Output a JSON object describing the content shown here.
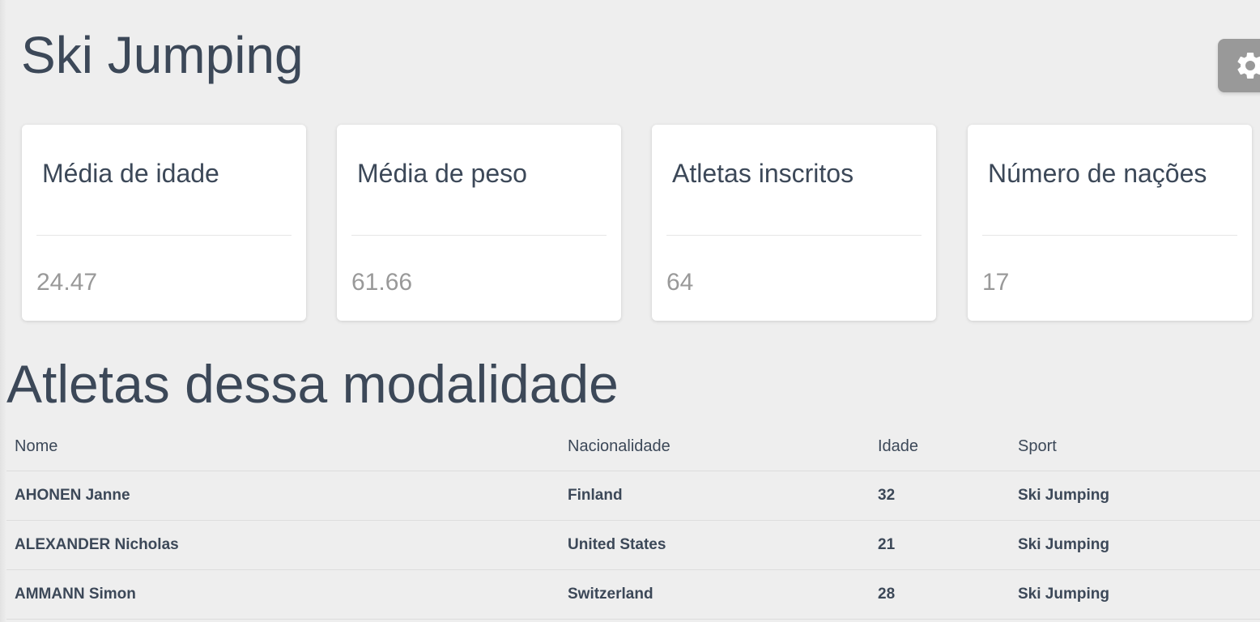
{
  "page": {
    "title": "Ski Jumping"
  },
  "settings": {
    "icon": "gear-icon"
  },
  "stats": [
    {
      "label": "Média de idade",
      "value": "24.47"
    },
    {
      "label": "Média de peso",
      "value": "61.66"
    },
    {
      "label": "Atletas inscritos",
      "value": "64"
    },
    {
      "label": "Número de nações",
      "value": "17"
    }
  ],
  "athletes": {
    "title": "Atletas dessa modalidade",
    "columns": [
      "Nome",
      "Nacionalidade",
      "Idade",
      "Sport"
    ],
    "rows": [
      [
        "AHONEN Janne",
        "Finland",
        "32",
        "Ski Jumping"
      ],
      [
        "ALEXANDER Nicholas",
        "United States",
        "21",
        "Ski Jumping"
      ],
      [
        "AMMANN Simon",
        "Switzerland",
        "28",
        "Ski Jumping"
      ]
    ]
  },
  "colors": {
    "background": "#eeeeee",
    "text": "#3c4858",
    "muted": "#999999",
    "card": "#ffffff",
    "settings_button": "#999999"
  }
}
